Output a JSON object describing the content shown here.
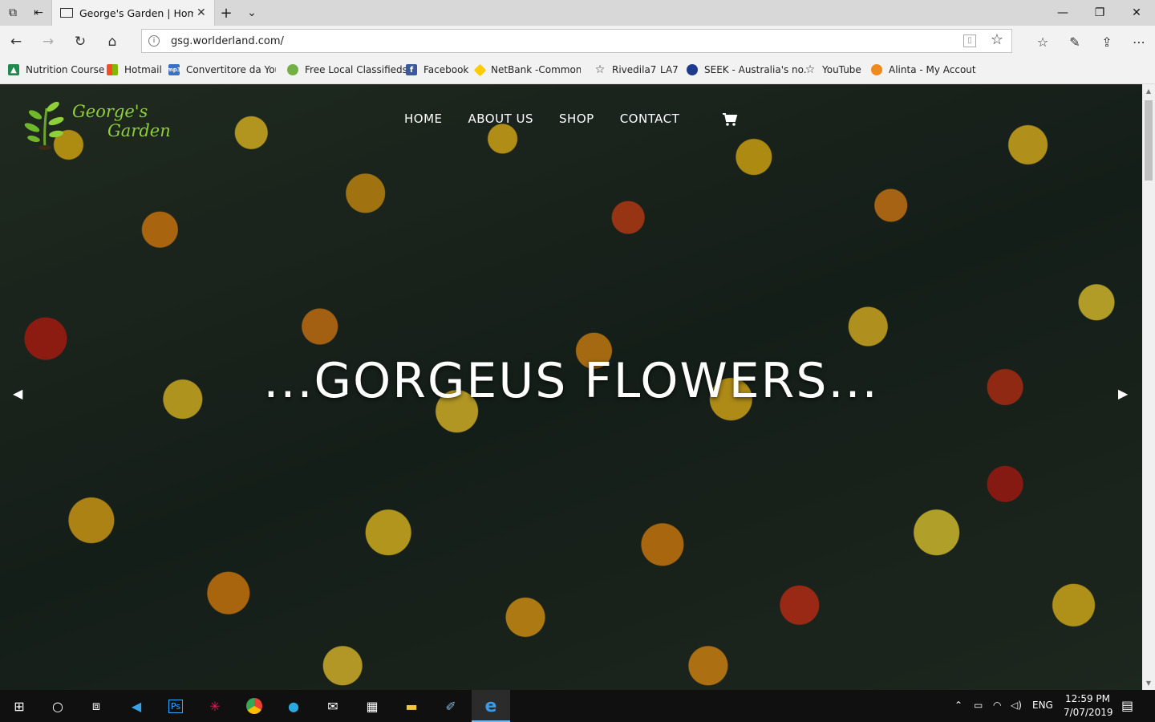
{
  "browser": {
    "tab_title": "George's Garden | Hom",
    "url": "gsg.worlderland.com/",
    "favorites": [
      {
        "label": "Nutrition Course",
        "icon": "graduation-cap-icon",
        "color": "#1f8a4c"
      },
      {
        "label": "Hotmail",
        "icon": "windows-logo-icon",
        "color": "#f25022"
      },
      {
        "label": "Convertitore da Youtı",
        "icon": "mp3-icon",
        "color": "#3a6fc4"
      },
      {
        "label": "Free Local Classifieds",
        "icon": "gumtree-icon",
        "color": "#72b043"
      },
      {
        "label": "Facebook",
        "icon": "facebook-icon",
        "color": "#3b5998"
      },
      {
        "label": "NetBank -Commonw",
        "icon": "commbank-icon",
        "color": "#ffcc00"
      },
      {
        "label": "Rivedila7",
        "icon": "star-icon",
        "color": "#333333"
      },
      {
        "label": "LA7",
        "icon": "",
        "color": ""
      },
      {
        "label": "SEEK - Australia's no.",
        "icon": "seek-icon",
        "color": "#1c3b8c"
      },
      {
        "label": "YouTube",
        "icon": "star-icon",
        "color": "#333333"
      },
      {
        "label": "Alinta - My Accout",
        "icon": "alinta-icon",
        "color": "#f08a1d"
      }
    ]
  },
  "site": {
    "logo_line1": "George's",
    "logo_line2": "Garden",
    "nav": [
      "HOME",
      "ABOUT US",
      "SHOP",
      "CONTACT"
    ],
    "hero_title": "...GORGEUS FLOWERS...",
    "prev_arrow": "◀",
    "next_arrow": "▶"
  },
  "taskbar": {
    "lang": "ENG",
    "time": "12:59 PM",
    "date": "7/07/2019"
  },
  "colors": {
    "logo_green": "#8fd03a",
    "taskbar_bg": "#101010",
    "chrome_bg": "#f2f2f2"
  }
}
